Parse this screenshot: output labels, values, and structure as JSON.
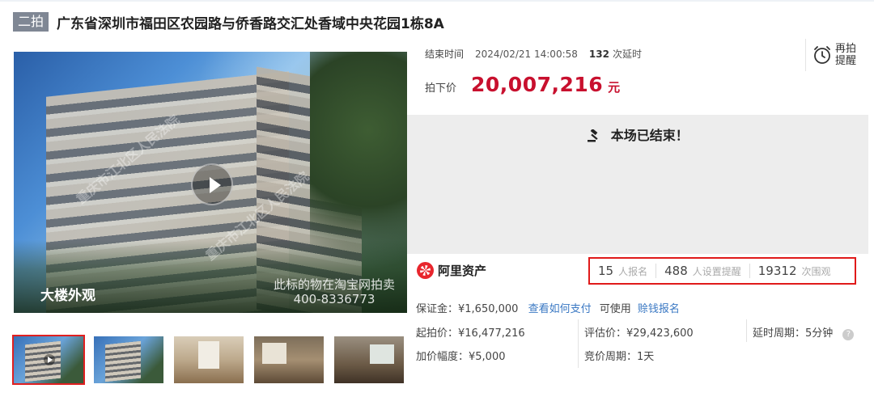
{
  "header": {
    "round_tag": "二拍",
    "title": "广东省深圳市福田区农园路与侨香路交汇处香域中央花园1栋8A"
  },
  "gallery": {
    "caption": "大楼外观",
    "notice": "此标的物在淘宝网拍卖",
    "phone": "400-8336773",
    "watermark_1": "重庆市江北区人民法院",
    "watermark_2": "重庆市江北区人民法院",
    "thumbnails": [
      "exterior-video",
      "exterior",
      "interior-living",
      "interior-dining",
      "interior-room"
    ]
  },
  "auction": {
    "end_label": "结束时间",
    "end_time": "2024/02/21 14:00:58",
    "delay_count": "132",
    "delay_unit": "次延时",
    "price_label": "拍下价",
    "price_value": "20,007,216",
    "price_unit": "元",
    "remind_label": "再拍提醒",
    "ended_message": "本场已结束！"
  },
  "stats": {
    "brand": "阿里资产",
    "signups_num": "15",
    "signups_label": "人报名",
    "reminders_num": "488",
    "reminders_label": "人设置提醒",
    "views_num": "19312",
    "views_label": "次围观"
  },
  "details": {
    "deposit": "保证金：¥1,650,000",
    "how_to_pay": "查看如何支付",
    "can_use": "可使用",
    "credit_signup": "赊钱报名",
    "start_price": "起拍价：¥16,477,216",
    "appraisal": "评估价：¥29,423,600",
    "delay_period": "延时周期：5分钟",
    "increment": "加价幅度：¥5,000",
    "bid_period": "竞价周期：1天"
  },
  "colors": {
    "price_red": "#c8102e",
    "highlight_box": "#e01a1a",
    "link_blue": "#3a78c3",
    "tag_grey": "#7f8794"
  }
}
